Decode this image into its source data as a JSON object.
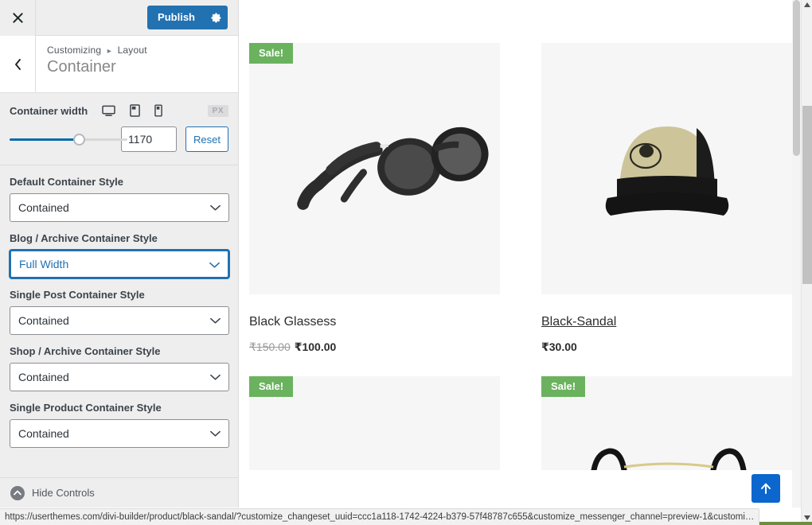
{
  "customizer": {
    "close_icon": "close-icon",
    "publish_label": "Publish",
    "gear_icon": "gear-icon",
    "back_icon": "chevron-left-icon",
    "breadcrumb_root": "Customizing",
    "breadcrumb_separator": "▸",
    "breadcrumb_section": "Layout",
    "panel_title": "Container",
    "hide_controls_label": "Hide Controls",
    "collapse_icon": "collapse-icon",
    "accent_color": "#2271b1"
  },
  "container_width": {
    "label": "Container width",
    "devices": [
      {
        "name": "desktop-icon",
        "active": true
      },
      {
        "name": "tablet-icon",
        "active": false
      },
      {
        "name": "mobile-icon",
        "active": false
      }
    ],
    "unit": "PX",
    "value": "1170",
    "slider_percent": 57,
    "reset_label": "Reset"
  },
  "style_selects": [
    {
      "label": "Default Container Style",
      "value": "Contained",
      "focused": false
    },
    {
      "label": "Blog / Archive Container Style",
      "value": "Full Width",
      "focused": true
    },
    {
      "label": "Single Post Container Style",
      "value": "Contained",
      "focused": false
    },
    {
      "label": "Shop / Archive Container Style",
      "value": "Contained",
      "focused": false
    },
    {
      "label": "Single Product Container Style",
      "value": "Contained",
      "focused": false
    }
  ],
  "select_options": [
    "Contained",
    "Full Width"
  ],
  "preview": {
    "sale_badge_label": "Sale!",
    "sale_badge_color": "#6bb25f",
    "products": [
      {
        "sale": true,
        "image": "black-sunglasses-image",
        "title": "Black Glassess",
        "price_old": "₹150.00",
        "price_new": "₹100.00",
        "hovered": false
      },
      {
        "sale": false,
        "image": "straw-cap-image",
        "title": "Black-Sandal",
        "price_old": "",
        "price_new": "₹30.00",
        "hovered": true
      },
      {
        "sale": true,
        "image": "product-image-3",
        "title": "",
        "price_old": "",
        "price_new": "",
        "hovered": false
      },
      {
        "sale": true,
        "image": "eyeglasses-image",
        "title": "",
        "price_old": "",
        "price_new": "",
        "hovered": false
      }
    ],
    "scroll_top_icon": "arrow-up-icon"
  },
  "status_bar": {
    "url": "https://userthemes.com/divi-builder/product/black-sandal/?customize_changeset_uuid=ccc1a118-1742-4224-b379-57f48787c655&customize_messenger_channel=preview-1&customi…"
  }
}
